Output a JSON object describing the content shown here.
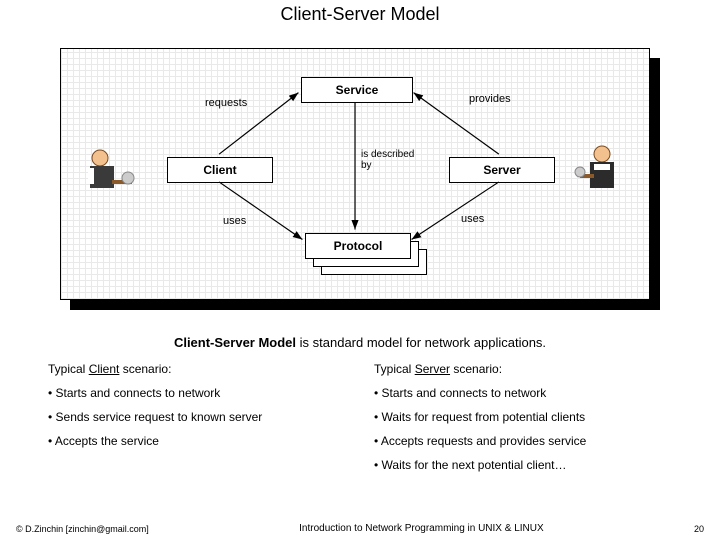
{
  "title": "Client-Server Model",
  "diagram": {
    "service": "Service",
    "requests": "requests",
    "provides": "provides",
    "client": "Client",
    "described": "is described\nby",
    "server": "Server",
    "uses_left": "uses",
    "uses_right": "uses",
    "protocol": "Protocol"
  },
  "intro_prefix": "Client-Server Model",
  "intro_rest": " is standard model for network applications.",
  "left": {
    "heading_pre": "Typical ",
    "heading_u": "Client",
    "heading_post": " scenario:",
    "b1": "• Starts and connects to network",
    "b2": "• Sends service request to known server",
    "b3": "• Accepts the service"
  },
  "right": {
    "heading_pre": "Typical ",
    "heading_u": "Server",
    "heading_post": " scenario:",
    "b1": "• Starts and connects to network",
    "b2": "• Waits for request from potential clients",
    "b3": "• Accepts requests and provides service",
    "b4": "• Waits for the next potential client…"
  },
  "footer": {
    "left": "© D.Zinchin [zinchin@gmail.com]",
    "center": "Introduction to Network Programming in UNIX & LINUX",
    "right": "20"
  }
}
